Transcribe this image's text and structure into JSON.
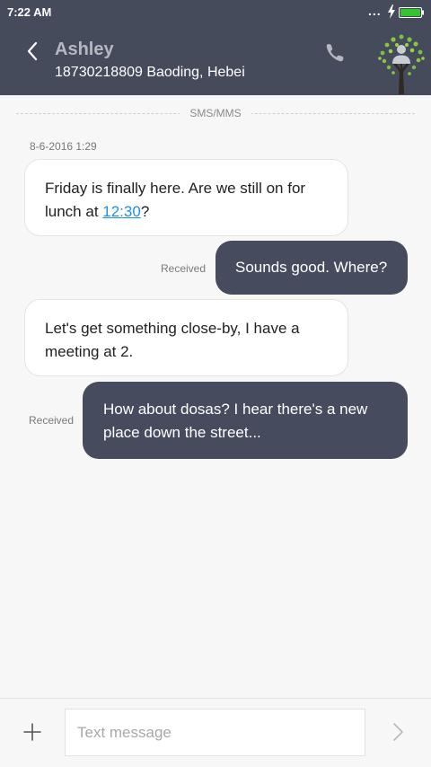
{
  "status_bar": {
    "time": "7:22 AM",
    "overflow_dots": "...",
    "battery_color": "#34c233"
  },
  "header": {
    "contact_name": "Ashley",
    "contact_subtitle": "18730218809 Baoding, Hebei",
    "background": "#454b5b",
    "back_icon": "chevron-left-icon",
    "call_icon": "phone-icon",
    "avatar_icon": "tree-avatar-icon"
  },
  "conversation": {
    "channel_label": "SMS/MMS",
    "timestamp": "8-6-2016 1:29",
    "messages": [
      {
        "direction": "incoming",
        "text_before_link": "Friday is finally here. Are we still on for lunch at ",
        "link_text": "12:30",
        "text_after_link": "?"
      },
      {
        "direction": "outgoing",
        "status": "Received",
        "text": "Sounds good. Where?"
      },
      {
        "direction": "incoming",
        "text": "Let's get something close-by, I have a meeting at 2."
      },
      {
        "direction": "outgoing",
        "status": "Received",
        "text": "How about dosas? I hear there's a new place down the street..."
      }
    ]
  },
  "composer": {
    "placeholder": "Text message",
    "value": "",
    "attach_icon": "plus-icon",
    "send_icon": "chevron-right-icon"
  }
}
